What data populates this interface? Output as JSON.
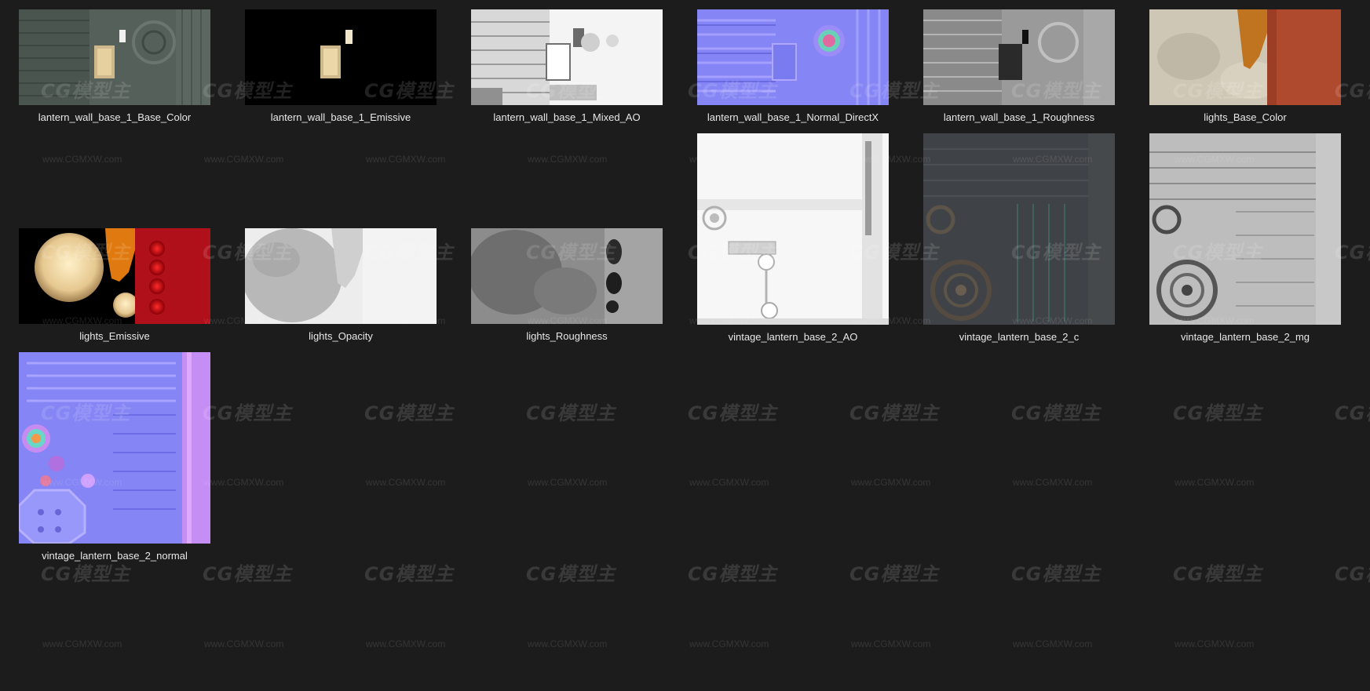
{
  "watermark": {
    "logo_text": "CG模型主",
    "url_text": "www.CGMXW.com"
  },
  "files": [
    {
      "name": "lantern_wall_base_1_Base_Color",
      "preview": "base-color-texture"
    },
    {
      "name": "lantern_wall_base_1_Emissive",
      "preview": "emissive-texture"
    },
    {
      "name": "lantern_wall_base_1_Mixed_AO",
      "preview": "ao-texture"
    },
    {
      "name": "lantern_wall_base_1_Normal_DirectX",
      "preview": "normal-map-texture"
    },
    {
      "name": "lantern_wall_base_1_Roughness",
      "preview": "roughness-texture"
    },
    {
      "name": "lights_Base_Color",
      "preview": "base-color-texture"
    },
    {
      "name": "lights_Emissive",
      "preview": "emissive-texture"
    },
    {
      "name": "lights_Opacity",
      "preview": "opacity-texture"
    },
    {
      "name": "lights_Roughness",
      "preview": "roughness-texture"
    },
    {
      "name": "vintage_lantern_base_2_AO",
      "preview": "ao-texture"
    },
    {
      "name": "vintage_lantern_base_2_c",
      "preview": "base-color-texture"
    },
    {
      "name": "vintage_lantern_base_2_mg",
      "preview": "metal-gloss-texture"
    },
    {
      "name": "vintage_lantern_base_2_normal",
      "preview": "normal-map-texture"
    }
  ],
  "colors": {
    "background": "#1c1c1c",
    "caption_text": "#e8e8e8",
    "normal_map_purple": "#8585f5",
    "emissive_red": "#c8101a",
    "emissive_orange": "#e07a10"
  }
}
